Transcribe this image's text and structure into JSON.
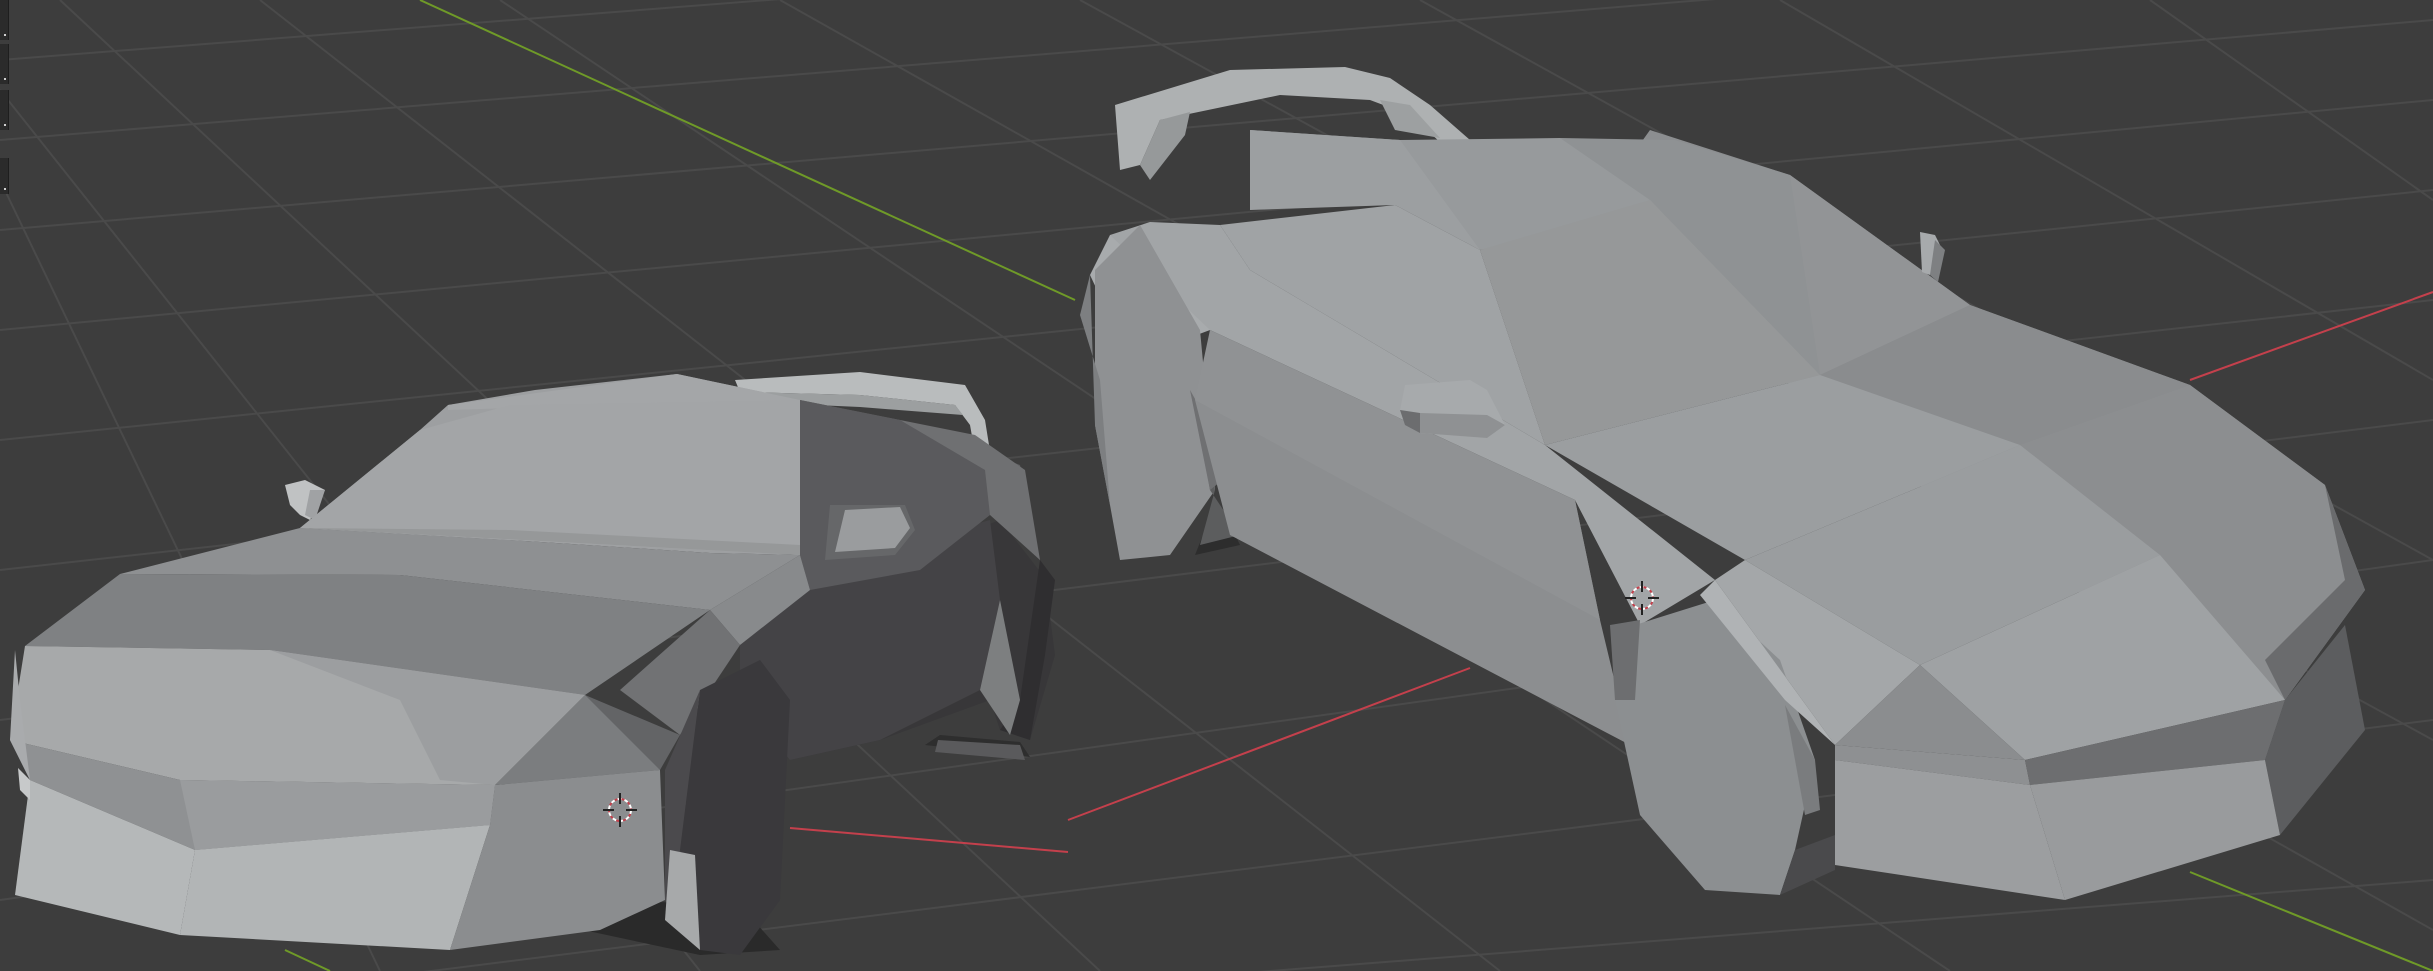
{
  "viewport": {
    "background": "#3d3d3d",
    "grid_color": "#4a4a4a",
    "x_axis_color": "#c4404c",
    "y_axis_color": "#6f9a28"
  },
  "toolbar": {
    "tools": [
      "select-box-tool",
      "cursor-tool",
      "move-tool",
      "rotate-tool"
    ]
  },
  "objects": [
    {
      "name": "car-front-left",
      "material_color": "#a3a6a7"
    },
    {
      "name": "car-back-right",
      "material_color": "#a3a6a7"
    }
  ]
}
